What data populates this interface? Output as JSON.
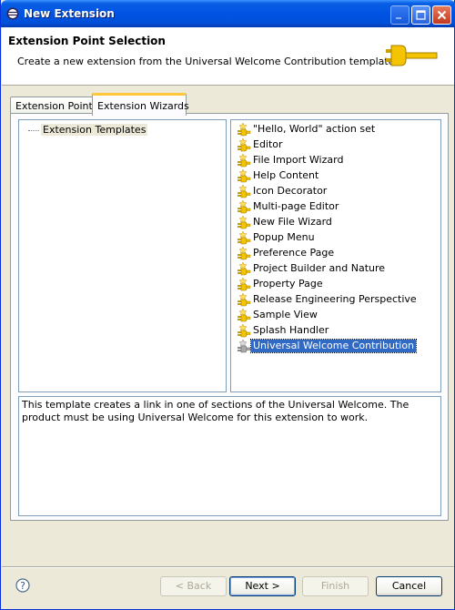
{
  "window": {
    "title": "New Extension"
  },
  "header": {
    "title": "Extension Point Selection",
    "description": "Create a new extension from the Universal Welcome Contribution template."
  },
  "tabs": [
    {
      "label": "Extension Points",
      "active": false
    },
    {
      "label": "Extension Wizards",
      "active": true
    }
  ],
  "tree": {
    "root_label": "Extension Templates"
  },
  "templates": [
    {
      "label": "\"Hello, World\" action set",
      "selected": false
    },
    {
      "label": "Editor",
      "selected": false
    },
    {
      "label": "File Import Wizard",
      "selected": false
    },
    {
      "label": "Help Content",
      "selected": false
    },
    {
      "label": "Icon Decorator",
      "selected": false
    },
    {
      "label": "Multi-page Editor",
      "selected": false
    },
    {
      "label": "New File Wizard",
      "selected": false
    },
    {
      "label": "Popup Menu",
      "selected": false
    },
    {
      "label": "Preference Page",
      "selected": false
    },
    {
      "label": "Project Builder and Nature",
      "selected": false
    },
    {
      "label": "Property Page",
      "selected": false
    },
    {
      "label": "Release Engineering Perspective",
      "selected": false
    },
    {
      "label": "Sample View",
      "selected": false
    },
    {
      "label": "Splash Handler",
      "selected": false
    },
    {
      "label": "Universal Welcome Contribution",
      "selected": true
    }
  ],
  "description": "This template creates a link in one of sections of the Universal Welcome. The product must be using Universal Welcome for this extension to work.",
  "buttons": {
    "back": "< Back",
    "next": "Next >",
    "finish": "Finish",
    "cancel": "Cancel"
  },
  "icons": {
    "app": "eclipse-icon",
    "header": "plug-icon",
    "template": "template-plugin-icon",
    "help": "help-icon"
  },
  "colors": {
    "selection": "#316ac5",
    "titlebar": "#0054e3",
    "active_tab_accent": "#ffc83c"
  }
}
